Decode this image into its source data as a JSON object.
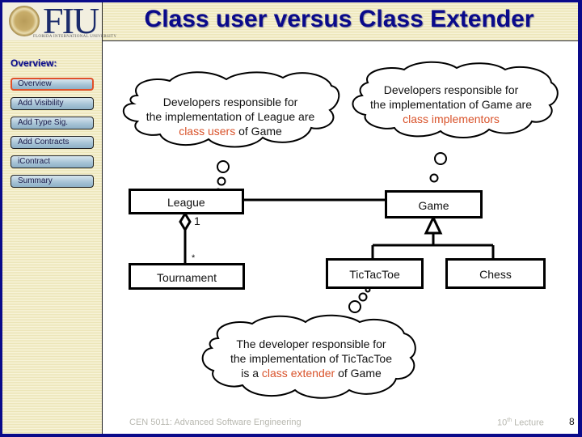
{
  "header": {
    "logo_text": "FIU",
    "logo_subtext": "FLORIDA INTERNATIONAL UNIVERSITY",
    "title": "Class user versus Class Extender"
  },
  "sidebar": {
    "heading": "Overview:",
    "items": [
      {
        "label": "Overview",
        "active": true
      },
      {
        "label": "Add Visibility",
        "active": false
      },
      {
        "label": "Add Type Sig.",
        "active": false
      },
      {
        "label": "Add Contracts",
        "active": false
      },
      {
        "label": "iContract",
        "active": false
      },
      {
        "label": "Summary",
        "active": false
      }
    ]
  },
  "callouts": {
    "league": {
      "line1": "Developers responsible for",
      "line2": "the implementation of League are",
      "highlight": "class users",
      "rest": " of Game"
    },
    "game": {
      "line1": "Developers responsible for",
      "line2": "the implementation  of Game are",
      "highlight": "class implementors"
    },
    "tictactoe": {
      "line1": "The developer responsible for",
      "line2": "the implementation of  TicTacToe",
      "prefix": "is a ",
      "highlight": "class extender",
      "rest": " of Game"
    }
  },
  "diagram": {
    "classes": {
      "league": "League",
      "game": "Game",
      "tournament": "Tournament",
      "tictactoe": "TicTacToe",
      "chess": "Chess"
    },
    "multiplicity_one": "1",
    "multiplicity_many": "*"
  },
  "colors": {
    "frame": "#0a0a8a",
    "title": "#0a0a8a",
    "highlight": "#d9532b",
    "active_border": "#e0502a"
  },
  "footer": {
    "course": "CEN 5011: Advanced Software Engineering",
    "lecture_num": "10",
    "lecture_sup": "th",
    "lecture_word": "Lecture",
    "page": "8"
  }
}
